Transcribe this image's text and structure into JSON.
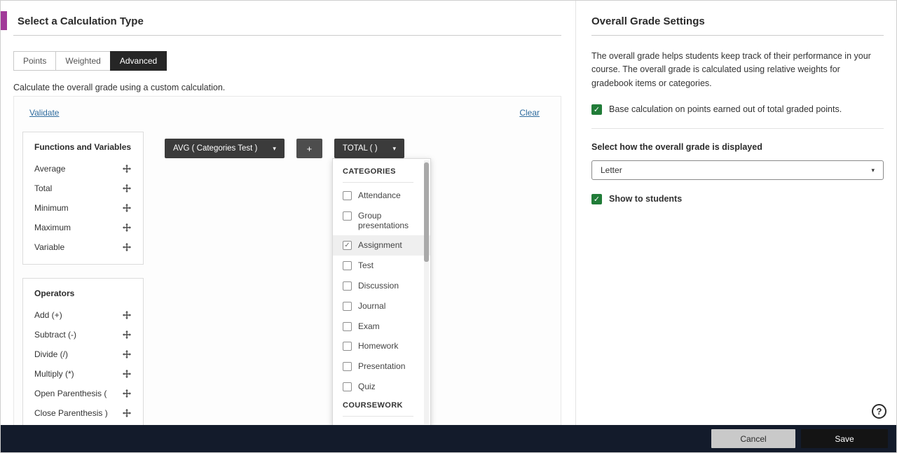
{
  "colors": {
    "accent": "#a13a99",
    "checkbox_green": "#217c38",
    "link_blue": "#2f6c9e",
    "chip_dark": "#3b3b3b",
    "footer_bar": "#131b2b"
  },
  "calculation_panel": {
    "title": "Select a Calculation Type",
    "tabs": [
      {
        "label": "Points",
        "active": false
      },
      {
        "label": "Weighted",
        "active": false
      },
      {
        "label": "Advanced",
        "active": true
      }
    ],
    "description": "Calculate the overall grade using a custom calculation.",
    "validate_label": "Validate",
    "clear_label": "Clear",
    "functions": {
      "title": "Functions and Variables",
      "items": [
        "Average",
        "Total",
        "Minimum",
        "Maximum",
        "Variable"
      ]
    },
    "operators": {
      "title": "Operators",
      "items": [
        "Add (+)",
        "Subtract (-)",
        "Divide (/)",
        "Multiply (*)",
        "Open Parenthesis (",
        "Close Parenthesis )"
      ]
    },
    "expression": {
      "avg_chip": "AVG ( Categories Test )",
      "plus_chip": "+",
      "total_chip": "TOTAL ( )"
    },
    "dropdown": {
      "categories_header": "CATEGORIES",
      "items": [
        {
          "label": "Attendance",
          "checked": false
        },
        {
          "label": "Group presentations",
          "checked": false
        },
        {
          "label": "Assignment",
          "checked": true
        },
        {
          "label": "Test",
          "checked": false
        },
        {
          "label": "Discussion",
          "checked": false
        },
        {
          "label": "Journal",
          "checked": false
        },
        {
          "label": "Exam",
          "checked": false
        },
        {
          "label": "Homework",
          "checked": false
        },
        {
          "label": "Presentation",
          "checked": false
        },
        {
          "label": "Quiz",
          "checked": false
        }
      ],
      "coursework_header": "COURSEWORK"
    }
  },
  "overall_grade_settings": {
    "title": "Overall Grade Settings",
    "description": "The overall grade helps students keep track of their performance in your course. The overall grade is calculated using relative weights for gradebook items or categories.",
    "base_points": {
      "label": "Base calculation on points earned out of total graded points.",
      "checked": true
    },
    "display_label": "Select how the overall grade is displayed",
    "display_value": "Letter",
    "show_to_students": {
      "label": "Show to students",
      "checked": true
    }
  },
  "footer": {
    "cancel_label": "Cancel",
    "save_label": "Save"
  },
  "help_label": "?"
}
